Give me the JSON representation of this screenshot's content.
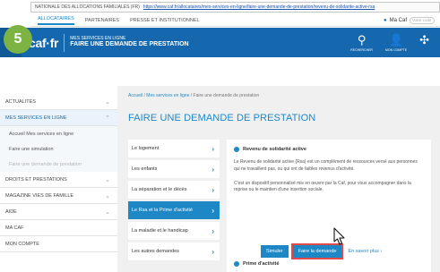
{
  "step_badge": "5",
  "browser": {
    "site_label": "NATIONALE DES ALLOCATIONS FAMILIALES (FR)",
    "url": "https://www.caf.fr/allocataires/mes-services-en-ligne/faire-une-demande-de-prestation/revenu-de-solidarite-active-rsa"
  },
  "topnav": {
    "tabs": [
      "ALLOCATAIRES",
      "PARTENAIRES",
      "PRESSE ET INSTITUTIONNEL"
    ],
    "caf_label": "Ma Caf",
    "search_placeholder": "Votre code"
  },
  "header": {
    "menu_label": "MENU",
    "logo": "caf·fr",
    "services_line1": "MES SERVICES EN LIGNE",
    "services_line2": "FAIRE UNE DEMANDE DE PRESTATION",
    "icons": [
      {
        "glyph": "⚲",
        "label": "RECHERCHER",
        "icon": "search-icon"
      },
      {
        "glyph": "👤",
        "label": "MON COMPTE",
        "icon": "account-icon"
      },
      {
        "glyph": "✣",
        "label": "",
        "icon": "caf-emblem-icon"
      }
    ]
  },
  "sidebar": {
    "items": [
      {
        "label": "ACTUALITÉS",
        "chevron": "⌄",
        "active": false
      },
      {
        "label": "MES SERVICES EN LIGNE",
        "chevron": "⌃",
        "active": true
      }
    ],
    "subitems": [
      {
        "label": "Accueil Mes services en ligne",
        "muted": false
      },
      {
        "label": "Faire une simulation",
        "muted": false
      },
      {
        "label": "Faire une demande de prestation",
        "muted": true
      }
    ],
    "items_after": [
      {
        "label": "DROITS ET PRESTATIONS",
        "chevron": "⌄"
      },
      {
        "label": "MAGAZINE VIES DE FAMILLE",
        "chevron": "⌄"
      },
      {
        "label": "AIDE",
        "chevron": "⌄"
      },
      {
        "label": "MA CAF",
        "chevron": ""
      },
      {
        "label": "MON COMPTE",
        "chevron": ""
      }
    ]
  },
  "breadcrumb": {
    "home": "Accueil",
    "mid": "Mes services en ligne",
    "current": "Faire une demande de prestation",
    "sep": "/"
  },
  "page_title": "FAIRE UNE DEMANDE DE PRESTATION",
  "categories": [
    {
      "label": "Le logement",
      "active": false
    },
    {
      "label": "Les enfants",
      "active": false
    },
    {
      "label": "La séparation et le décès",
      "active": false
    },
    {
      "label": "Le Rsa et la Prime d'activité",
      "active": true
    },
    {
      "label": "La maladie et le handicap",
      "active": false
    },
    {
      "label": "Les autres demandes",
      "active": false
    }
  ],
  "panel": {
    "heading": "Revenu de solidarité active",
    "para1": "Le Revenu de solidarité active (Rsa) est un complément de ressources versé aux personnes qui ne travaillent pas, ou qui ont de faibles revenus d'activité.",
    "para2": "C'est un dispositif personnalisé mis en œuvre par la Caf, pour vous accompagner dans la reprise ou le maintien d'une insertion sociale.",
    "btn_simulate": "Simuler",
    "btn_request": "Faire la demande",
    "btn_more": "En savoir plus",
    "more_arrow": "›",
    "footer_heading": "Prime d'activité"
  },
  "arrow_glyph": "›",
  "colors": {
    "header_blue": "#1568ad",
    "accent_blue": "#1e88c7",
    "badge_green": "#7cb342",
    "highlight_red": "#e24a4a"
  }
}
